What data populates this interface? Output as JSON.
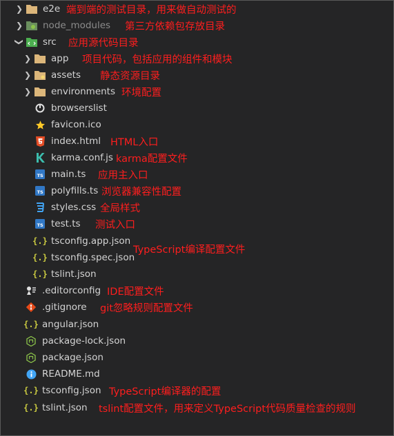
{
  "tree": {
    "e2e": {
      "label": "e2e",
      "note": "端到端的测试目录，用来做自动测试的",
      "icon": "folder-icon"
    },
    "node_modules": {
      "label": "node_modules",
      "note": "第三方依赖包存放目录",
      "icon": "node-folder-icon"
    },
    "src": {
      "label": "src",
      "note": "应用源代码目录",
      "icon": "src-folder-icon"
    },
    "app": {
      "label": "app",
      "note": "项目代码，包括应用的组件和模块",
      "icon": "folder-icon"
    },
    "assets": {
      "label": "assets",
      "note": "静态资源目录",
      "icon": "folder-icon"
    },
    "environments": {
      "label": "environments",
      "note": "环境配置",
      "icon": "folder-icon"
    },
    "browserslist": {
      "label": "browserslist",
      "note": "",
      "icon": "browserslist-icon"
    },
    "favicon": {
      "label": "favicon.ico",
      "note": "",
      "icon": "star-icon"
    },
    "index_html": {
      "label": "index.html",
      "note": "HTML入口",
      "icon": "html5-icon"
    },
    "karma": {
      "label": "karma.conf.js",
      "note": "karma配置文件",
      "icon": "karma-icon"
    },
    "main": {
      "label": "main.ts",
      "note": "应用主入口",
      "icon": "typescript-icon"
    },
    "polyfills": {
      "label": "polyfills.ts",
      "note": "浏览器兼容性配置",
      "icon": "typescript-icon"
    },
    "styles": {
      "label": "styles.css",
      "note": "全局样式",
      "icon": "css3-icon"
    },
    "test": {
      "label": "test.ts",
      "note": "测试入口",
      "icon": "typescript-icon"
    },
    "tsconfig_app": {
      "label": "tsconfig.app.json",
      "note": "",
      "icon": "json-braces-icon"
    },
    "tsconfig_spec": {
      "label": "tsconfig.spec.json",
      "note": "TypeScript编译配置文件",
      "icon": "json-braces-icon"
    },
    "tslint_src": {
      "label": "tslint.json",
      "note": "",
      "icon": "json-braces-icon"
    },
    "editorconfig": {
      "label": ".editorconfig",
      "note": "IDE配置文件",
      "icon": "editorconfig-icon"
    },
    "gitignore": {
      "label": ".gitignore",
      "note": "git忽略规则配置文件",
      "icon": "git-icon"
    },
    "angular": {
      "label": "angular.json",
      "note": "",
      "icon": "json-braces-icon"
    },
    "package_lock": {
      "label": "package-lock.json",
      "note": "",
      "icon": "npm-icon"
    },
    "package": {
      "label": "package.json",
      "note": "",
      "icon": "npm-icon"
    },
    "readme": {
      "label": "README.md",
      "note": "",
      "icon": "info-icon"
    },
    "tsconfig": {
      "label": "tsconfig.json",
      "note": "TypeScript编译器的配置",
      "icon": "json-braces-icon"
    },
    "tslint": {
      "label": "tslint.json",
      "note": "tslint配置文件，用来定义TypeScript代码质量检查的规则",
      "icon": "json-braces-icon"
    }
  },
  "colors": {
    "background": "#252526",
    "text": "#d4d4d4",
    "annotation": "#ff1e1e",
    "folder": "#dcb67a",
    "typescript": "#3178c6",
    "html": "#e44d26",
    "css": "#42a5f5",
    "json": "#cbcb41"
  }
}
